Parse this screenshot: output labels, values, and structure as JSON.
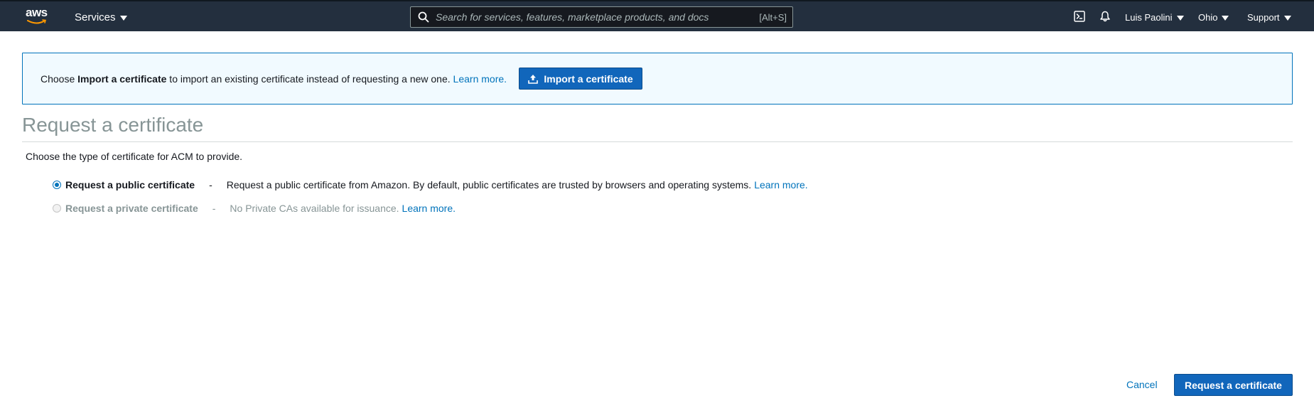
{
  "topnav": {
    "logo_text": "aws",
    "services_label": "Services",
    "search": {
      "placeholder": "Search for services, features, marketplace products, and docs",
      "shortcut": "[Alt+S]"
    },
    "icons": [
      "cloudshell-icon",
      "bell-icon"
    ],
    "user_label": "Luis Paolini",
    "region_label": "Ohio",
    "support_label": "Support"
  },
  "banner": {
    "prefix": "Choose ",
    "emphasis": "Import a certificate",
    "suffix": " to import an existing certificate instead of requesting a new one. ",
    "link": "Learn more.",
    "button_label": "Import a certificate"
  },
  "main": {
    "title": "Request a certificate",
    "intro": "Choose the type of certificate for ACM to provide.",
    "options": [
      {
        "label": "Request a public certificate",
        "separator": "-",
        "description": "Request a public certificate from Amazon. By default, public certificates are trusted by browsers and operating systems.",
        "link": "Learn more.",
        "selected": true,
        "disabled": false
      },
      {
        "label": "Request a private certificate",
        "separator": "-",
        "description": "No Private CAs available for issuance.",
        "link": "Learn more.",
        "selected": false,
        "disabled": true
      }
    ]
  },
  "footer": {
    "cancel_label": "Cancel",
    "submit_label": "Request a certificate"
  },
  "colors": {
    "nav_bg": "#232f3e",
    "accent": "#0073bb",
    "primary_button": "#1166bb",
    "banner_bg": "#f1faff",
    "aws_orange": "#ff9900"
  }
}
